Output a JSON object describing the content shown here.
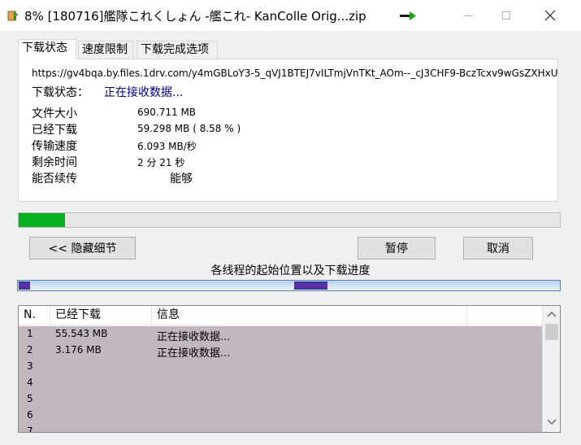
{
  "window": {
    "title": "8% [180716]艦隊これくしょん -艦これ- KanColle Orig...zip",
    "controls": [
      "minimize",
      "maximize",
      "close"
    ]
  },
  "tabs": [
    {
      "label": "下载状态",
      "active": true
    },
    {
      "label": "速度限制",
      "active": false
    },
    {
      "label": "下载完成选项",
      "active": false
    }
  ],
  "download": {
    "url": "https://gv4bqa.by.files.1drv.com/y4mGBLoY3-5_qVJ1BTEJ7vILTmjVnTKt_AOm--_cJ3CHF9-BczTcxv9wGsZXHxU",
    "status_label": "下载状态：",
    "status_value": "正在接收数据...",
    "info": [
      {
        "label": "文件大小",
        "value": "690.711  MB"
      },
      {
        "label": "已经下载",
        "value": "59.298  MB ( 8.58 % )"
      },
      {
        "label": "传输速度",
        "value": "6.093  MB/秒"
      },
      {
        "label": "剩余时间",
        "value": "2 分 21 秒"
      },
      {
        "label": "能否续传",
        "value": "能够"
      }
    ],
    "progress_percent": 8.58,
    "progress_color": "#06b025"
  },
  "buttons": {
    "hide_details": "<< 隐藏细节",
    "pause": "暂停",
    "cancel": "取消"
  },
  "threads": {
    "caption": "各线程的起始位置以及下载进度"
  },
  "thread_list": {
    "columns": [
      "N.",
      "已经下载",
      "信息"
    ],
    "rows": [
      {
        "n": "1",
        "downloaded": "55.543  MB",
        "info": "正在接收数据..."
      },
      {
        "n": "2",
        "downloaded": "3.176  MB",
        "info": "正在接收数据..."
      },
      {
        "n": "3",
        "downloaded": "",
        "info": ""
      },
      {
        "n": "4",
        "downloaded": "",
        "info": ""
      },
      {
        "n": "5",
        "downloaded": "",
        "info": ""
      },
      {
        "n": "6",
        "downloaded": "",
        "info": ""
      },
      {
        "n": "7",
        "downloaded": "",
        "info": ""
      }
    ],
    "row_color": "#c2b6bf"
  }
}
